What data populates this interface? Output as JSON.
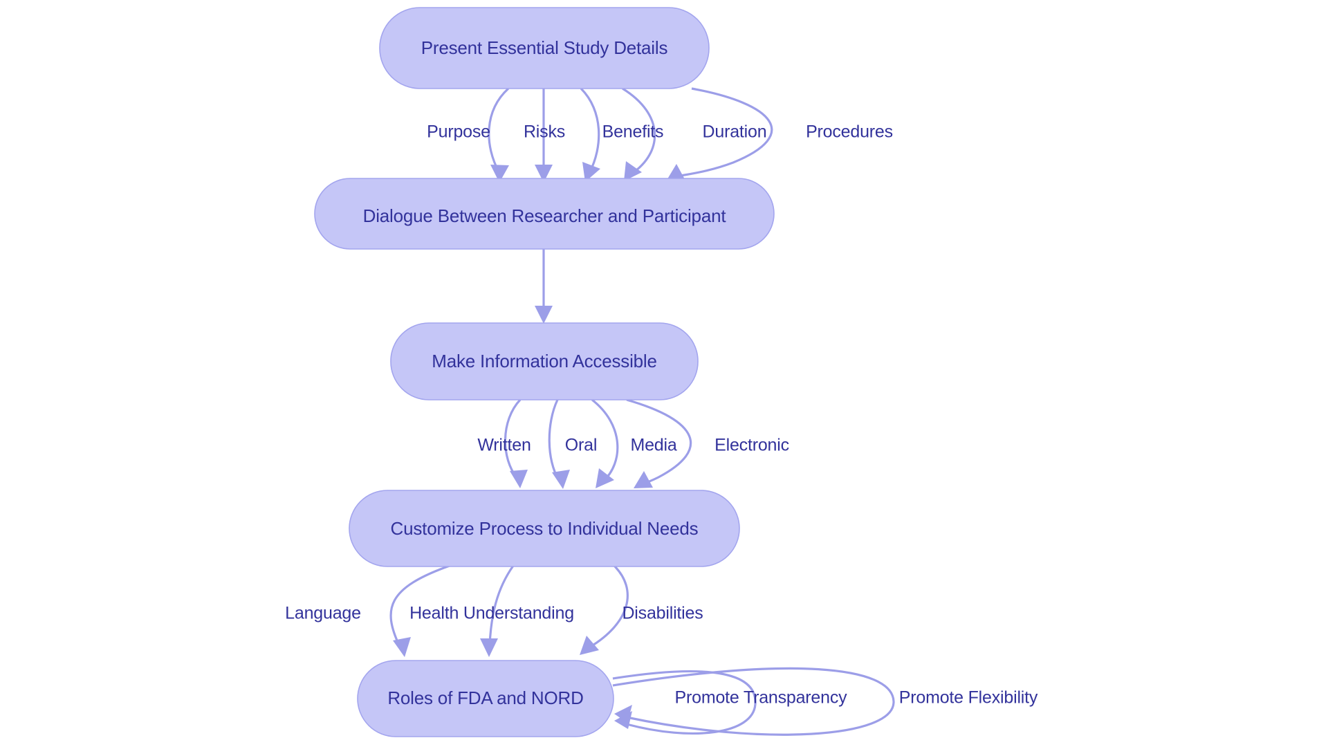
{
  "diagram": {
    "type": "flowchart",
    "orientation": "top-to-bottom",
    "background_color": "#ffffff",
    "node_fill_color": "#c5c6f7",
    "node_border_color": "#a3a5ee",
    "node_text_color": "#32329b",
    "edge_color": "#9c9ee8",
    "title": "",
    "nodes": [
      {
        "id": "n1",
        "label": "Present Essential Study Details"
      },
      {
        "id": "n2",
        "label": "Dialogue Between Researcher and Participant"
      },
      {
        "id": "n3",
        "label": "Make Information Accessible"
      },
      {
        "id": "n4",
        "label": "Customize Process to Individual Needs"
      },
      {
        "id": "n5",
        "label": "Roles of FDA and NORD"
      }
    ],
    "edges": [
      {
        "from": "n1",
        "to": "n2",
        "label": "Purpose"
      },
      {
        "from": "n1",
        "to": "n2",
        "label": "Risks"
      },
      {
        "from": "n1",
        "to": "n2",
        "label": "Benefits"
      },
      {
        "from": "n1",
        "to": "n2",
        "label": "Duration"
      },
      {
        "from": "n1",
        "to": "n2",
        "label": "Procedures"
      },
      {
        "from": "n2",
        "to": "n3",
        "label": ""
      },
      {
        "from": "n3",
        "to": "n4",
        "label": "Written"
      },
      {
        "from": "n3",
        "to": "n4",
        "label": "Oral"
      },
      {
        "from": "n3",
        "to": "n4",
        "label": "Media"
      },
      {
        "from": "n3",
        "to": "n4",
        "label": "Electronic"
      },
      {
        "from": "n4",
        "to": "n5",
        "label": "Language"
      },
      {
        "from": "n4",
        "to": "n5",
        "label": "Health Understanding"
      },
      {
        "from": "n4",
        "to": "n5",
        "label": "Disabilities"
      },
      {
        "from": "n5",
        "to": "n5",
        "label": "Promote Transparency"
      },
      {
        "from": "n5",
        "to": "n5",
        "label": "Promote Flexibility"
      }
    ]
  }
}
